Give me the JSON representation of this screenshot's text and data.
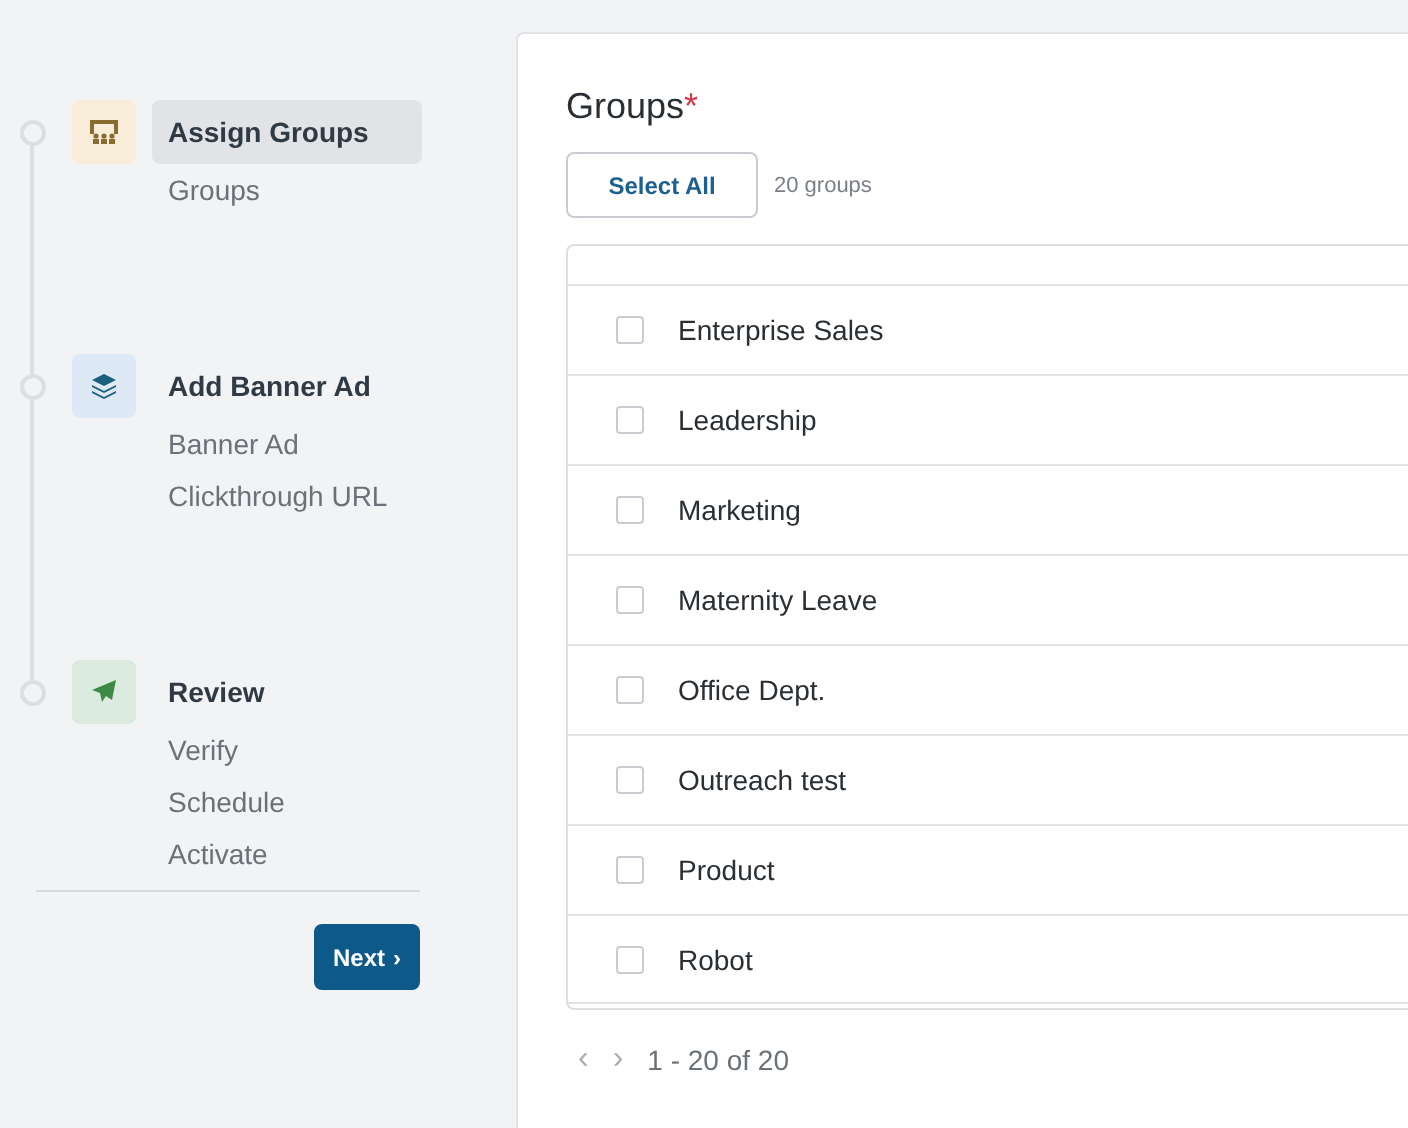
{
  "steps": [
    {
      "title": "Assign Groups",
      "kind": "groups",
      "selected": true,
      "items": [
        "Groups"
      ]
    },
    {
      "title": "Add Banner Ad",
      "kind": "layers",
      "selected": false,
      "items": [
        "Banner Ad",
        "Clickthrough URL"
      ]
    },
    {
      "title": "Review",
      "kind": "send",
      "selected": false,
      "items": [
        "Verify",
        "Schedule",
        "Activate"
      ]
    }
  ],
  "next_button": {
    "label": "Next",
    "icon": "›"
  },
  "groups": {
    "title": "Groups",
    "required_mark": "*",
    "select_all": "Select All",
    "count": "20 groups",
    "rows": [
      {
        "name": "Enterprise Sales",
        "checked": false
      },
      {
        "name": "Leadership",
        "checked": false
      },
      {
        "name": "Marketing",
        "checked": false
      },
      {
        "name": "Maternity Leave",
        "checked": false
      },
      {
        "name": "Office Dept.",
        "checked": false
      },
      {
        "name": "Outreach test",
        "checked": false
      },
      {
        "name": "Product",
        "checked": false
      },
      {
        "name": "Robot",
        "checked": false
      }
    ],
    "pagination": {
      "prev": "‹",
      "next": "›",
      "range": "1 - 20 of 20"
    }
  }
}
